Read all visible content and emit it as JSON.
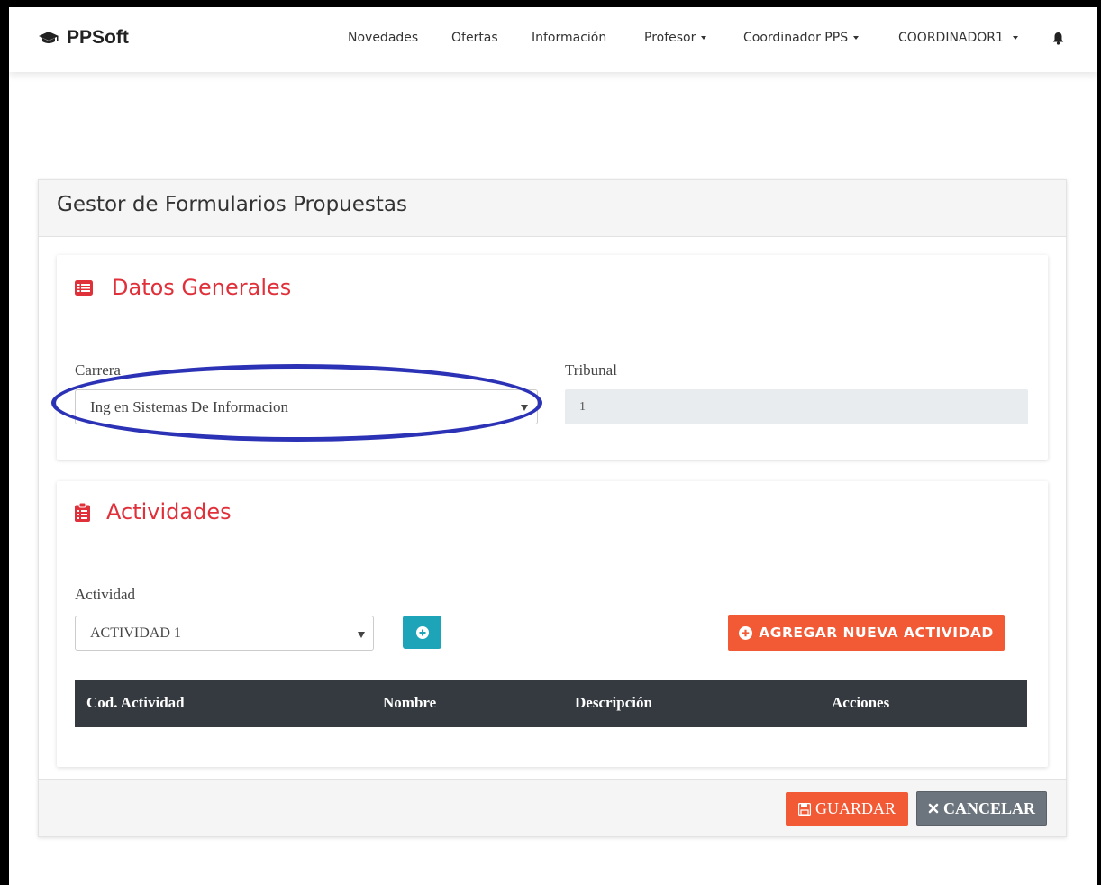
{
  "navbar": {
    "brand": "PPSoft",
    "items": [
      {
        "label": "Novedades"
      },
      {
        "label": "Ofertas"
      },
      {
        "label": "Información"
      },
      {
        "label": "Profesor"
      },
      {
        "label": "Coordinador PPS"
      },
      {
        "label": "COORDINADOR1"
      }
    ]
  },
  "panel": {
    "title": "Gestor de Formularios Propuestas"
  },
  "datos_generales": {
    "title": "Datos Generales",
    "carrera_label": "Carrera",
    "carrera_value": "Ing en Sistemas De Informacion",
    "tribunal_label": "Tribunal",
    "tribunal_value": "1"
  },
  "actividades": {
    "title": "Actividades",
    "actividad_label": "Actividad",
    "actividad_value": "ACTIVIDAD 1",
    "add_new_label": "AGREGAR NUEVA ACTIVIDAD",
    "table_headers": [
      "Cod. Actividad",
      "Nombre",
      "Descripción",
      "Acciones"
    ]
  },
  "footer": {
    "save_label": "GUARDAR",
    "cancel_label": "CANCELAR"
  },
  "colors": {
    "accent_red": "#e0303a",
    "button_orange": "#f25a36",
    "button_teal": "#1ea4b8",
    "table_header": "#343a40",
    "annotation_blue": "#2c32b5"
  }
}
